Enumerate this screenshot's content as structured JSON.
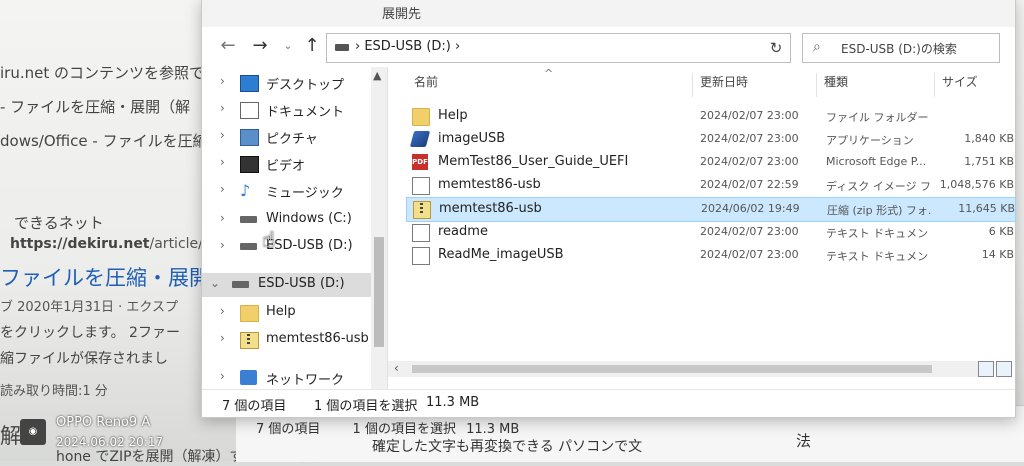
{
  "background_page": {
    "line1": "iru.net のコンテンツを参照で",
    "line2": "- ファイルを圧縮・展開（解",
    "line3": "dows/Office - ファイルを圧縮",
    "site_name": "できるネット",
    "url_prefix": "https://dekiru.net",
    "url_suffix": "/article/",
    "heading": "ファイルを圧縮・展開",
    "meta": "ブ 2020年1月31日 · エクスプ",
    "step": "をクリックします。 2ファー",
    "saved": "縮ファイルが保存されまし",
    "read_time": "読み取り時間:1 分",
    "kai": "解",
    "bottom_text": "hone でZIPを展開（解凍）する方法。複",
    "right_note": "法"
  },
  "back_window": {
    "item_count": "7 個の項目",
    "selected": "1 個の項目を選択",
    "size": "11.3 MB",
    "overlay_text": "確定した文字も再変換できる パソコンで文"
  },
  "explorer": {
    "title": "展開先",
    "address": "ESD-USB (D:)",
    "address_sep": "›",
    "search_placeholder": "ESD-USB (D:)の検索",
    "columns": {
      "name": "名前",
      "date": "更新日時",
      "type": "種類",
      "size": "サイズ"
    },
    "nav_items": [
      {
        "label": "デスクトップ",
        "icon": "desktop-icon"
      },
      {
        "label": "ドキュメント",
        "icon": "documents-icon"
      },
      {
        "label": "ピクチャ",
        "icon": "pictures-icon"
      },
      {
        "label": "ビデオ",
        "icon": "videos-icon"
      },
      {
        "label": "ミュージック",
        "icon": "music-icon"
      },
      {
        "label": "Windows (C:)",
        "icon": "drive-icon"
      },
      {
        "label": "ESD-USB (D:)",
        "icon": "drive-icon"
      },
      {
        "label": "ESD-USB (D:)",
        "icon": "drive-icon"
      },
      {
        "label": "Help",
        "icon": "folder-icon"
      },
      {
        "label": "memtest86-usb",
        "icon": "zip-icon"
      },
      {
        "label": "ネットワーク",
        "icon": "network-icon"
      }
    ],
    "files": [
      {
        "name": "Help",
        "date": "2024/02/07 23:00",
        "type": "ファイル フォルダー",
        "size": "",
        "icon": "folder-icon"
      },
      {
        "name": "imageUSB",
        "date": "2024/02/07 23:00",
        "type": "アプリケーション",
        "size": "1,840 KB",
        "icon": "app-icon"
      },
      {
        "name": "MemTest86_User_Guide_UEFI",
        "date": "2024/02/07 23:00",
        "type": "Microsoft Edge P...",
        "size": "1,751 KB",
        "icon": "pdf-icon"
      },
      {
        "name": "memtest86-usb",
        "date": "2024/02/07 22:59",
        "type": "ディスク イメージ ファ...",
        "size": "1,048,576 KB",
        "icon": "disc-image-icon"
      },
      {
        "name": "memtest86-usb",
        "date": "2024/06/02 19:49",
        "type": "圧縮 (zip 形式) フォ...",
        "size": "11,645 KB",
        "icon": "zip-icon"
      },
      {
        "name": "readme",
        "date": "2024/02/07 23:00",
        "type": "テキスト ドキュメント",
        "size": "6 KB",
        "icon": "text-doc-icon"
      },
      {
        "name": "ReadMe_imageUSB",
        "date": "2024/02/07 23:00",
        "type": "テキスト ドキュメント",
        "size": "14 KB",
        "icon": "text-doc-icon"
      }
    ],
    "status": {
      "count": "7 個の項目",
      "selected": "1 個の項目を選択",
      "size": "11.3 MB"
    }
  },
  "watermark": {
    "device": "OPPO Reno9 A",
    "timestamp": "2024.06.02 20:17",
    "logo": "◉"
  },
  "colors": {
    "selection": "#cce8ff",
    "folder": "#f1cf6a",
    "pdf": "#c9302c"
  }
}
